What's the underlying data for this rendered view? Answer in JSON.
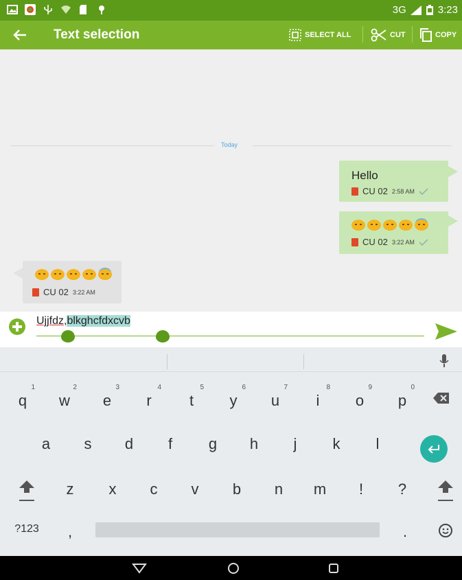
{
  "status_bar": {
    "network": "3G",
    "time": "3:23"
  },
  "action_bar": {
    "title": "Text selection",
    "actions": [
      {
        "label": "SELECT ALL",
        "icon": "select-all-icon"
      },
      {
        "label": "CUT",
        "icon": "scissors-icon"
      },
      {
        "label": "COPY",
        "icon": "copy-icon"
      }
    ]
  },
  "chat": {
    "date_separator": "Today",
    "messages": [
      {
        "direction": "outgoing",
        "text": "Hello",
        "sender": "CU 02",
        "time": "2:58 AM",
        "status": "sent-check"
      },
      {
        "direction": "outgoing",
        "emoji_count": 5,
        "sender": "CU 02",
        "time": "3:22 AM",
        "status": "sent-check"
      },
      {
        "direction": "incoming",
        "emoji_count": 5,
        "sender": "CU 02",
        "time": "3:22 AM"
      }
    ]
  },
  "composer": {
    "text_plain": "Ujjfdz,",
    "text_selected": "blkghcfdxcvb"
  },
  "keyboard": {
    "row1": [
      {
        "k": "q",
        "h": "1"
      },
      {
        "k": "w",
        "h": "2"
      },
      {
        "k": "e",
        "h": "3"
      },
      {
        "k": "r",
        "h": "4"
      },
      {
        "k": "t",
        "h": "5"
      },
      {
        "k": "y",
        "h": "6"
      },
      {
        "k": "u",
        "h": "7"
      },
      {
        "k": "i",
        "h": "8"
      },
      {
        "k": "o",
        "h": "9"
      },
      {
        "k": "p",
        "h": "0"
      }
    ],
    "row2": [
      "a",
      "s",
      "d",
      "f",
      "g",
      "h",
      "j",
      "k",
      "l"
    ],
    "row3": [
      "z",
      "x",
      "c",
      "v",
      "b",
      "n",
      "m",
      "!",
      "?"
    ],
    "row4_left": "?123",
    "row4_comma": ",",
    "row4_period": "."
  },
  "colors": {
    "status_bar": "#5c9a1a",
    "action_bar": "#7bb42a",
    "outgoing_bubble": "#c8e7b4",
    "incoming_bubble": "#e2e2e2",
    "selection": "#a7dcd6",
    "enter_key": "#27b3a4"
  }
}
